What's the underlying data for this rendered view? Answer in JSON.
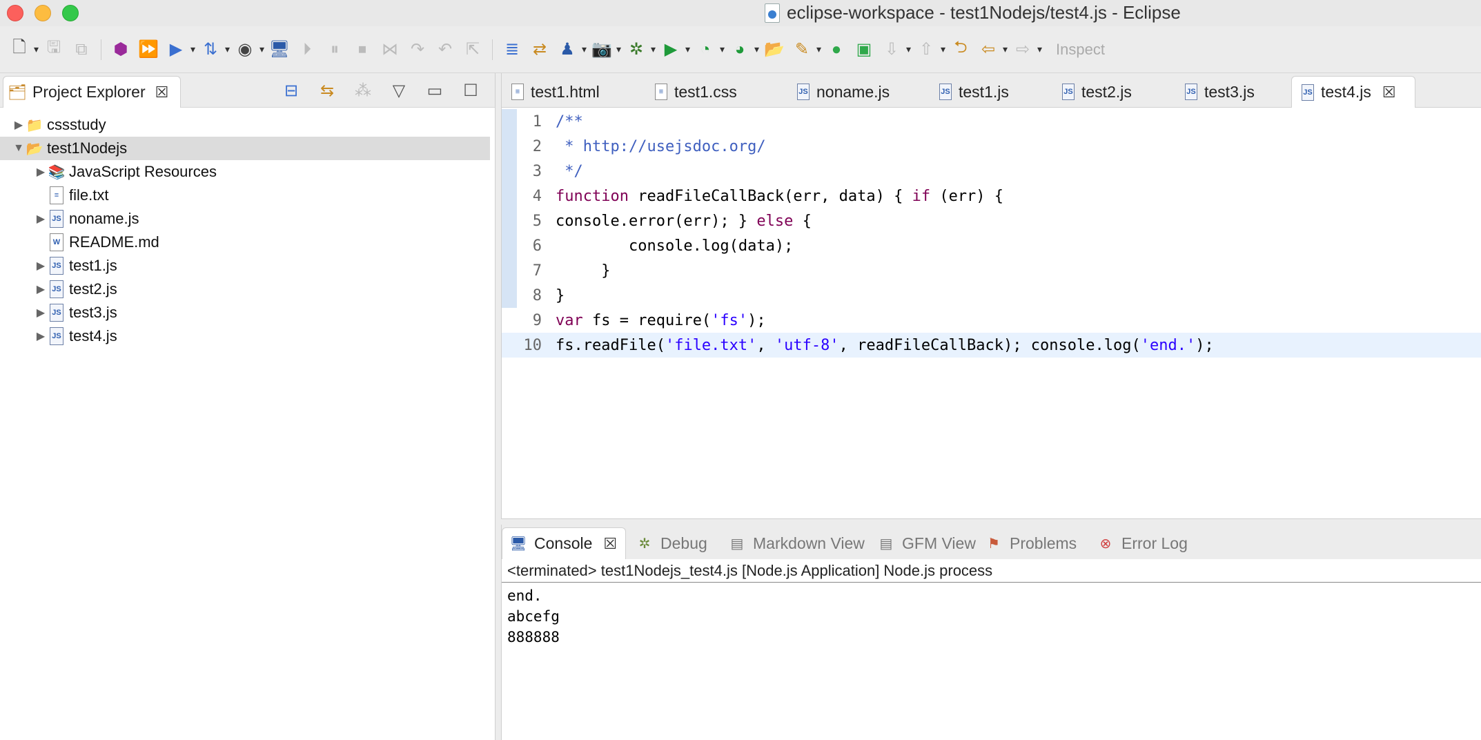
{
  "window": {
    "title": "eclipse-workspace - test1Nodejs/test4.js - Eclipse",
    "traffic_colors": {
      "close": "#fc605c",
      "minimize": "#fdbc40",
      "zoom": "#34c84a"
    }
  },
  "toolbar": {
    "inspect_label": "Inspect",
    "icons": [
      "new-wizard-icon",
      "save-icon",
      "save-all-icon",
      "skip-breakpoints-icon",
      "resume-icon",
      "run-icon",
      "terminate-icon",
      "open-perspective-icon",
      "user-icon",
      "console-icon",
      "step-into-icon",
      "suspend-icon",
      "stop-icon",
      "disconnect-icon",
      "step-over-icon",
      "step-return-icon",
      "drop-to-frame-icon",
      "use-step-filters-icon",
      "search-icon",
      "new-project-icon",
      "camera-icon",
      "debug-icon",
      "run-green-icon",
      "coverage-icon",
      "external-tools-icon",
      "open-folder-icon",
      "highlighter-icon",
      "green-ball-icon",
      "green-square-icon",
      "next-annotation-icon",
      "prev-annotation-icon",
      "last-edit-icon",
      "back-icon",
      "forward-icon"
    ]
  },
  "project_explorer": {
    "tab_label": "Project Explorer",
    "tree": [
      {
        "label": "cssstudy",
        "level": 0,
        "expanded": false,
        "icon": "project-icon"
      },
      {
        "label": "test1Nodejs",
        "level": 0,
        "expanded": true,
        "icon": "project-open-icon",
        "selected": true
      },
      {
        "label": "JavaScript Resources",
        "level": 1,
        "expanded": false,
        "icon": "library-icon"
      },
      {
        "label": "file.txt",
        "level": 1,
        "leaf": true,
        "icon": "text-file-icon"
      },
      {
        "label": "noname.js",
        "level": 1,
        "expanded": false,
        "icon": "js-file-icon"
      },
      {
        "label": "README.md",
        "level": 1,
        "leaf": true,
        "icon": "markdown-file-icon"
      },
      {
        "label": "test1.js",
        "level": 1,
        "expanded": false,
        "icon": "js-file-icon"
      },
      {
        "label": "test2.js",
        "level": 1,
        "expanded": false,
        "icon": "js-file-icon"
      },
      {
        "label": "test3.js",
        "level": 1,
        "expanded": false,
        "icon": "js-file-icon"
      },
      {
        "label": "test4.js",
        "level": 1,
        "expanded": false,
        "icon": "js-file-icon"
      }
    ]
  },
  "editor": {
    "tabs": [
      {
        "label": "test1.html",
        "icon": "html-file-icon"
      },
      {
        "label": "test1.css",
        "icon": "css-file-icon"
      },
      {
        "label": "noname.js",
        "icon": "js-file-icon"
      },
      {
        "label": "test1.js",
        "icon": "js-file-icon"
      },
      {
        "label": "test2.js",
        "icon": "js-file-icon"
      },
      {
        "label": "test3.js",
        "icon": "js-file-icon"
      },
      {
        "label": "test4.js",
        "icon": "js-file-icon",
        "active": true
      }
    ],
    "line_numbers": [
      "1",
      "2",
      "3",
      "4",
      "5",
      "6",
      "7",
      "8",
      "9",
      "10"
    ],
    "current_line": 10,
    "code": {
      "l1": "/**",
      "l2": " * http://usejsdoc.org/",
      "l3": " */",
      "l4_kw": "function",
      "l4_rest": " readFileCallBack(err, data) { ",
      "l4_if": "if",
      "l4_end": " (err) {",
      "l5_a": "console.error(err); } ",
      "l5_else": "else",
      "l5_b": " {",
      "l6": "        console.log(data);",
      "l7": "     }",
      "l8": "}",
      "l9_kw": "var",
      "l9_a": " fs = require(",
      "l9_str": "'fs'",
      "l9_b": ");",
      "l10_a": "fs.readFile(",
      "l10_s1": "'file.txt'",
      "l10_c1": ", ",
      "l10_s2": "'utf-8'",
      "l10_b": ", readFileCallBack); console.log(",
      "l10_s3": "'end.'",
      "l10_c": ");"
    }
  },
  "console": {
    "tabs": [
      {
        "label": "Console",
        "icon": "console-icon",
        "active": true
      },
      {
        "label": "Debug",
        "icon": "debug-icon"
      },
      {
        "label": "Markdown View",
        "icon": "markdown-view-icon"
      },
      {
        "label": "GFM View",
        "icon": "gfm-view-icon"
      },
      {
        "label": "Problems",
        "icon": "problems-icon"
      },
      {
        "label": "Error Log",
        "icon": "error-log-icon"
      }
    ],
    "header": "<terminated> test1Nodejs_test4.js [Node.js Application] Node.js process",
    "output": [
      "end.",
      "abcefg",
      "888888"
    ]
  }
}
